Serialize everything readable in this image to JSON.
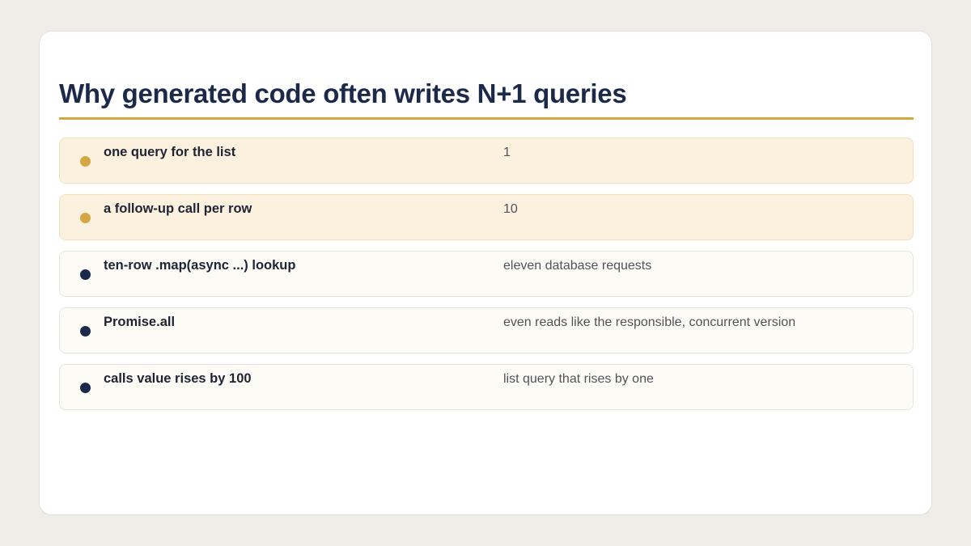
{
  "title": "Why generated code often writes N+1 queries",
  "colors": {
    "accent": "#d4a743",
    "highlight_dot": "#d4a743",
    "normal_dot": "#1b2a4a",
    "title": "#1b2a4a"
  },
  "rows": [
    {
      "label": "one query for the list",
      "value": "1",
      "highlighted": true
    },
    {
      "label": "a follow-up call per row",
      "value": "10",
      "highlighted": true
    },
    {
      "label": "ten-row .map(async ...) lookup",
      "value": "eleven database requests",
      "highlighted": false
    },
    {
      "label": "Promise.all",
      "value": "even reads like the responsible, concurrent version",
      "highlighted": false
    },
    {
      "label": "calls value rises by 100",
      "value": "list query that rises by one",
      "highlighted": false
    }
  ]
}
